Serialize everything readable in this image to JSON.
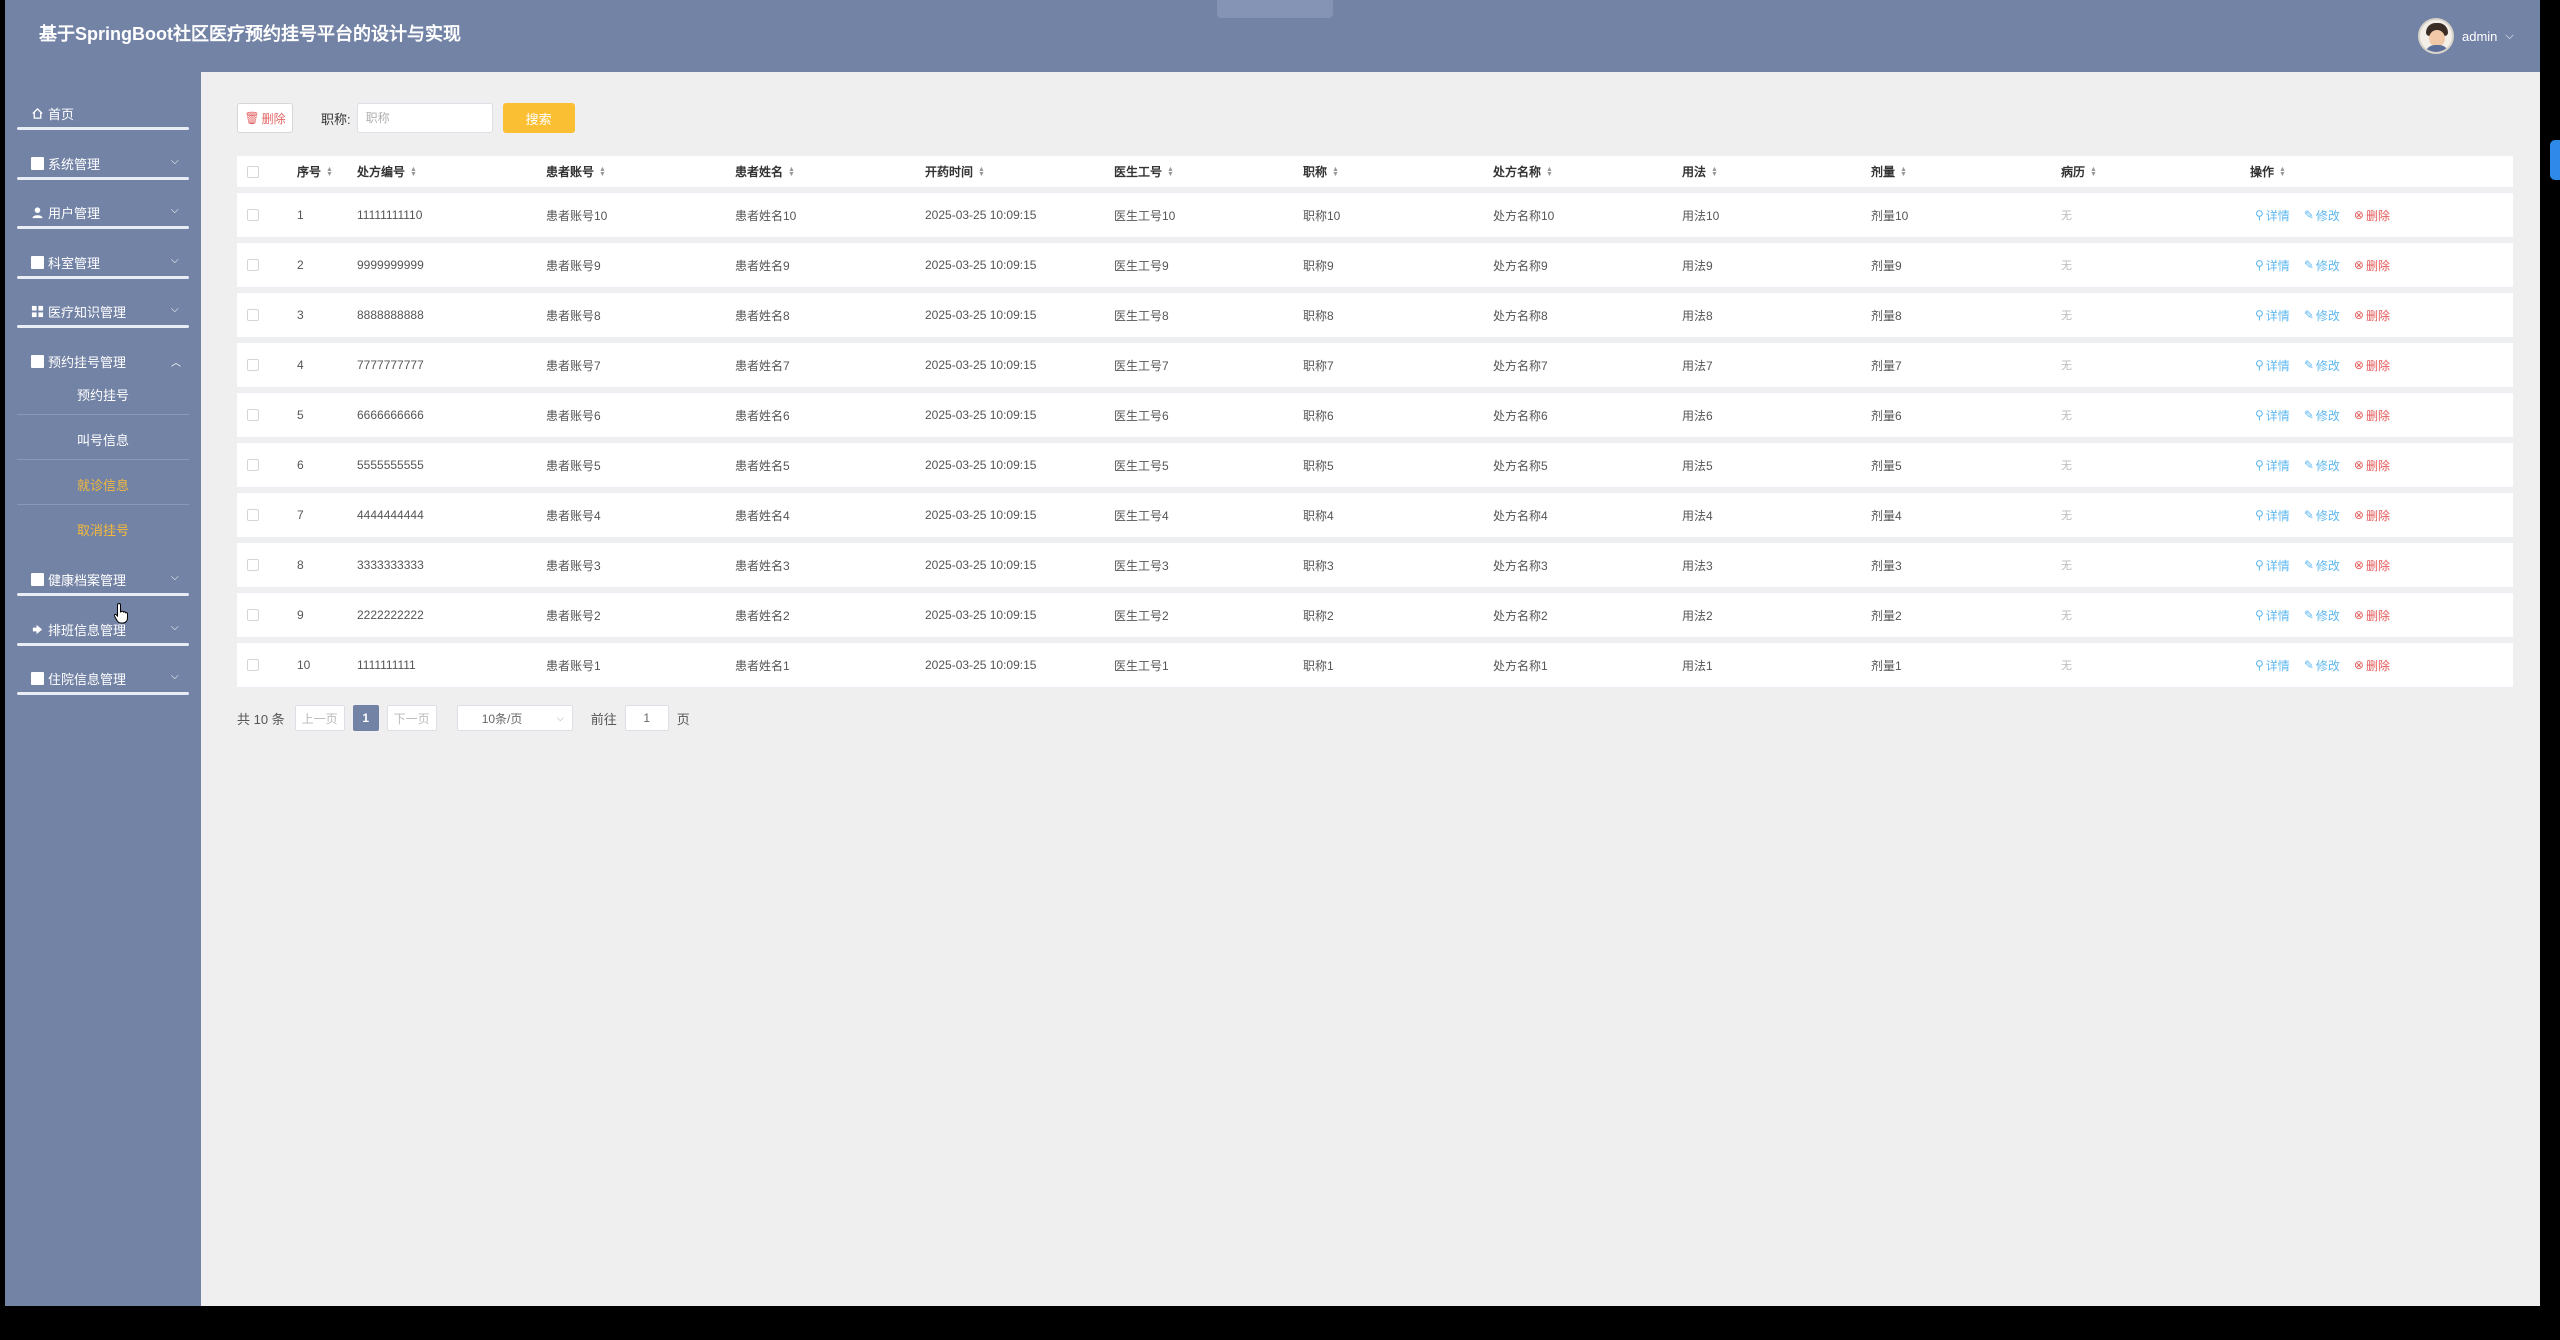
{
  "header": {
    "title": "基于SpringBoot社区医疗预约挂号平台的设计与实现",
    "user": "admin"
  },
  "sidebar": {
    "home": "首页",
    "menus": [
      {
        "label": "系统管理",
        "icon": "menu-icon"
      },
      {
        "label": "用户管理",
        "icon": "user-icon"
      },
      {
        "label": "科室管理",
        "icon": "menu-icon"
      },
      {
        "label": "医疗知识管理",
        "icon": "grid-icon"
      },
      {
        "label": "预约挂号管理",
        "icon": "menu-icon"
      }
    ],
    "sub_items": [
      "预约挂号",
      "叫号信息",
      "就诊信息",
      "取消挂号"
    ],
    "menus_after": [
      {
        "label": "健康档案管理",
        "icon": "menu-icon"
      },
      {
        "label": "排班信息管理",
        "icon": "link-icon"
      },
      {
        "label": "住院信息管理",
        "icon": "menu-icon"
      }
    ]
  },
  "toolbar": {
    "batch_delete": "删除",
    "search_label": "职称:",
    "search_placeholder": "职称",
    "search_button": "搜索"
  },
  "table": {
    "headers": [
      "序号",
      "处方编号",
      "患者账号",
      "患者姓名",
      "开药时间",
      "医生工号",
      "职称",
      "处方名称",
      "用法",
      "剂量",
      "病历",
      "操作"
    ],
    "actions": {
      "view": "详情",
      "edit": "修改",
      "delete": "删除"
    },
    "rows": [
      [
        "1",
        "11111111110",
        "患者账号10",
        "患者姓名10",
        "2025-03-25 10:09:15",
        "医生工号10",
        "职称10",
        "处方名称10",
        "用法10",
        "剂量10",
        "无"
      ],
      [
        "2",
        "9999999999",
        "患者账号9",
        "患者姓名9",
        "2025-03-25 10:09:15",
        "医生工号9",
        "职称9",
        "处方名称9",
        "用法9",
        "剂量9",
        "无"
      ],
      [
        "3",
        "8888888888",
        "患者账号8",
        "患者姓名8",
        "2025-03-25 10:09:15",
        "医生工号8",
        "职称8",
        "处方名称8",
        "用法8",
        "剂量8",
        "无"
      ],
      [
        "4",
        "7777777777",
        "患者账号7",
        "患者姓名7",
        "2025-03-25 10:09:15",
        "医生工号7",
        "职称7",
        "处方名称7",
        "用法7",
        "剂量7",
        "无"
      ],
      [
        "5",
        "6666666666",
        "患者账号6",
        "患者姓名6",
        "2025-03-25 10:09:15",
        "医生工号6",
        "职称6",
        "处方名称6",
        "用法6",
        "剂量6",
        "无"
      ],
      [
        "6",
        "5555555555",
        "患者账号5",
        "患者姓名5",
        "2025-03-25 10:09:15",
        "医生工号5",
        "职称5",
        "处方名称5",
        "用法5",
        "剂量5",
        "无"
      ],
      [
        "7",
        "4444444444",
        "患者账号4",
        "患者姓名4",
        "2025-03-25 10:09:15",
        "医生工号4",
        "职称4",
        "处方名称4",
        "用法4",
        "剂量4",
        "无"
      ],
      [
        "8",
        "3333333333",
        "患者账号3",
        "患者姓名3",
        "2025-03-25 10:09:15",
        "医生工号3",
        "职称3",
        "处方名称3",
        "用法3",
        "剂量3",
        "无"
      ],
      [
        "9",
        "2222222222",
        "患者账号2",
        "患者姓名2",
        "2025-03-25 10:09:15",
        "医生工号2",
        "职称2",
        "处方名称2",
        "用法2",
        "剂量2",
        "无"
      ],
      [
        "10",
        "1111111111",
        "患者账号1",
        "患者姓名1",
        "2025-03-25 10:09:15",
        "医生工号1",
        "职称1",
        "处方名称1",
        "用法1",
        "剂量1",
        "无"
      ]
    ]
  },
  "pager": {
    "total": "共 10 条",
    "prev": "上一页",
    "current": "1",
    "next": "下一页",
    "page_size": "10条/页",
    "goto_label": "前往",
    "goto_value": "1",
    "page_unit": "页"
  },
  "colors": {
    "sidebar": "#7383a6",
    "accent": "#fbbf34",
    "active_sub": "#f4b93b",
    "link": "#5fb8f0",
    "danger": "#e55b5b"
  }
}
